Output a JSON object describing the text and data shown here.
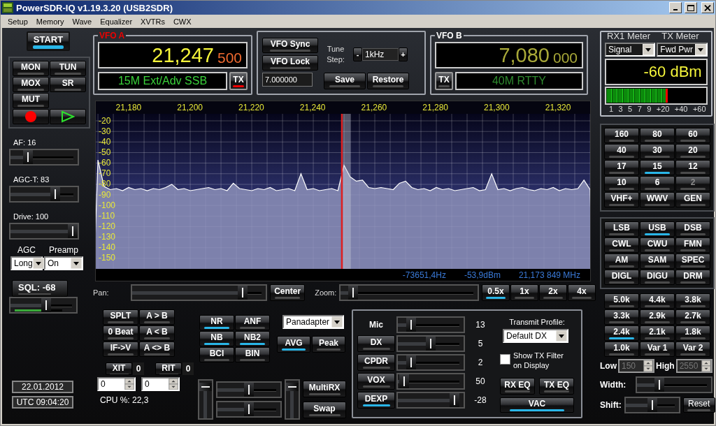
{
  "window": {
    "title": "PowerSDR-IQ v1.19.3.20 (USB2SDR)"
  },
  "menu": [
    "Setup",
    "Memory",
    "Wave",
    "Equalizer",
    "XVTRs",
    "CWX"
  ],
  "start_button": {
    "label": "START",
    "on": true
  },
  "main_buttons": [
    {
      "label": "MON",
      "on": false
    },
    {
      "label": "TUN",
      "on": false
    },
    {
      "label": "MOX",
      "on": false
    },
    {
      "label": "SR",
      "on": false
    },
    {
      "label": "MUT",
      "on": false
    }
  ],
  "left_sliders": [
    {
      "label": "AF:  16",
      "level": 0.22
    },
    {
      "label": "AGC-T:  83",
      "level": 0.7
    },
    {
      "label": "Drive:  100",
      "level": 1.0
    }
  ],
  "agc": {
    "label": "AGC",
    "value": "Long"
  },
  "preamp": {
    "label": "Preamp",
    "value": "On"
  },
  "squelch": {
    "label": "SQL:  -68",
    "on": false,
    "level": 0.55
  },
  "date": "22.01.2012",
  "time": "UTC 09:04:20",
  "vfo_a": {
    "title": "VFO A",
    "freq_main": "21,247",
    "freq_sub": "500",
    "band": "15M Ext/Adv SSB",
    "tx_label": "TX",
    "tx_on": true
  },
  "vfo_controls": {
    "sync": "VFO Sync",
    "lock": "VFO Lock",
    "freq_entry": "7.000000",
    "tune_step_label": "Tune Step:",
    "step_minus": "-",
    "step_value": "1kHz",
    "step_plus": "+",
    "save": "Save",
    "restore": "Restore"
  },
  "vfo_b": {
    "title": "VFO B",
    "freq_main": "7,080",
    "freq_sub": "000",
    "band": "40M RTTY",
    "tx_label": "TX",
    "tx_on": false
  },
  "meter": {
    "rx_title": "RX1 Meter",
    "tx_title": "TX Meter",
    "rx_mode": "Signal",
    "tx_mode": "Fwd Pwr",
    "reading": "-60 dBm",
    "level": 0.62,
    "scale": [
      "1",
      "3",
      "5",
      "7",
      "9",
      "+20",
      "+40",
      "+60"
    ]
  },
  "spectrum": {
    "chart_data": {
      "type": "area",
      "grid": true,
      "x": [
        21170,
        21172,
        21174,
        21176,
        21178,
        21180,
        21182,
        21184,
        21186,
        21188,
        21190,
        21192,
        21194,
        21196,
        21198,
        21200,
        21202,
        21204,
        21206,
        21208,
        21210,
        21212,
        21214,
        21216,
        21218,
        21220,
        21222,
        21224,
        21226,
        21228,
        21230,
        21232,
        21234,
        21236,
        21238,
        21240,
        21242,
        21244,
        21246,
        21248,
        21250,
        21252,
        21254,
        21256,
        21258,
        21260,
        21262,
        21264,
        21266,
        21268,
        21270,
        21272,
        21274,
        21276,
        21278,
        21280,
        21282,
        21284,
        21286,
        21288,
        21290,
        21292,
        21294,
        21296,
        21298,
        21300,
        21302,
        21304,
        21306,
        21308,
        21310,
        21312,
        21314,
        21316,
        21318,
        21320,
        21322,
        21324,
        21326,
        21328,
        21330
      ],
      "series": [
        {
          "color": "#ffffff",
          "values": [
            -57,
            -82,
            -85,
            -84,
            -86,
            -83,
            -85,
            -84,
            -86,
            -84,
            -85,
            -83,
            -80,
            -85,
            -84,
            -86,
            -85,
            -84,
            -83,
            -85,
            -84,
            -86,
            -79,
            -84,
            -85,
            -86,
            -84,
            -85,
            -83,
            -86,
            -85,
            -84,
            -86,
            -70,
            -85,
            -84,
            -86,
            -85,
            -84,
            -86,
            -62,
            -73,
            -77,
            -76,
            -83,
            -84,
            -83,
            -84,
            -85,
            -79,
            -77,
            -83,
            -85,
            -84,
            -86,
            -83,
            -85,
            -84,
            -86,
            -85,
            -84,
            -83,
            -86,
            -85,
            -70,
            -85,
            -84,
            -86,
            -84,
            -83,
            -85,
            -86,
            -84,
            -85,
            -83,
            -86,
            -84,
            -85,
            -84,
            -76,
            -85
          ]
        }
      ],
      "ref_lines": [
        {
          "axis": "x",
          "value": 21249.3,
          "color": "#e02020"
        }
      ],
      "bands": [
        {
          "axis": "x",
          "from": 21249.6,
          "to": 21252.2,
          "color": "#c8cad8"
        }
      ],
      "xlim": [
        21169.3,
        21330.0
      ],
      "ylim": [
        -159.9,
        -13.4
      ],
      "xticks": [
        {
          "value": 21180,
          "label": "21,180"
        },
        {
          "value": 21200,
          "label": "21,200"
        },
        {
          "value": 21220,
          "label": "21,220"
        },
        {
          "value": 21240,
          "label": "21,240"
        },
        {
          "value": 21260,
          "label": "21,260"
        },
        {
          "value": 21280,
          "label": "21,280"
        },
        {
          "value": 21300,
          "label": "21,300"
        },
        {
          "value": 21320,
          "label": "21,320"
        }
      ],
      "yticks": [
        -20,
        -30,
        -40,
        -50,
        -60,
        -70,
        -80,
        -90,
        -100,
        -110,
        -120,
        -130,
        -140,
        -150
      ]
    },
    "cursor_offset": "-73651,4Hz",
    "cursor_level": "-53,9dBm",
    "cursor_freq": "21,173 849 MHz"
  },
  "pan": {
    "label": "Pan:",
    "level": 0.85,
    "center": "Center"
  },
  "zoom": {
    "label": "Zoom:",
    "level": 0.06,
    "buttons": [
      {
        "label": "0.5x",
        "selected": true
      },
      {
        "label": "1x",
        "selected": false
      },
      {
        "label": "2x",
        "selected": false
      },
      {
        "label": "4x",
        "selected": false
      }
    ]
  },
  "bands": [
    {
      "label": "160",
      "selected": false,
      "disabled": false
    },
    {
      "label": "80",
      "selected": false,
      "disabled": false
    },
    {
      "label": "60",
      "selected": false,
      "disabled": false
    },
    {
      "label": "40",
      "selected": false,
      "disabled": false
    },
    {
      "label": "30",
      "selected": false,
      "disabled": false
    },
    {
      "label": "20",
      "selected": false,
      "disabled": false
    },
    {
      "label": "17",
      "selected": false,
      "disabled": false
    },
    {
      "label": "15",
      "selected": true,
      "disabled": false
    },
    {
      "label": "12",
      "selected": false,
      "disabled": false
    },
    {
      "label": "10",
      "selected": false,
      "disabled": false
    },
    {
      "label": "6",
      "selected": false,
      "disabled": false
    },
    {
      "label": "2",
      "selected": false,
      "disabled": true
    },
    {
      "label": "VHF+",
      "selected": false,
      "disabled": false
    },
    {
      "label": "WWV",
      "selected": false,
      "disabled": false
    },
    {
      "label": "GEN",
      "selected": false,
      "disabled": false
    }
  ],
  "modes": [
    {
      "label": "LSB",
      "selected": false
    },
    {
      "label": "USB",
      "selected": true
    },
    {
      "label": "DSB",
      "selected": false
    },
    {
      "label": "CWL",
      "selected": false
    },
    {
      "label": "CWU",
      "selected": false
    },
    {
      "label": "FMN",
      "selected": false
    },
    {
      "label": "AM",
      "selected": false
    },
    {
      "label": "SAM",
      "selected": false
    },
    {
      "label": "SPEC",
      "selected": false
    },
    {
      "label": "DIGL",
      "selected": false
    },
    {
      "label": "DIGU",
      "selected": false
    },
    {
      "label": "DRM",
      "selected": false
    }
  ],
  "filters": [
    {
      "label": "5.0k",
      "selected": false
    },
    {
      "label": "4.4k",
      "selected": false
    },
    {
      "label": "3.8k",
      "selected": false
    },
    {
      "label": "3.3k",
      "selected": false
    },
    {
      "label": "2.9k",
      "selected": false
    },
    {
      "label": "2.7k",
      "selected": false
    },
    {
      "label": "2.4k",
      "selected": true
    },
    {
      "label": "2.1k",
      "selected": false
    },
    {
      "label": "1.8k",
      "selected": false
    },
    {
      "label": "1.0k",
      "selected": false
    },
    {
      "label": "Var 1",
      "selected": false
    },
    {
      "label": "Var 2",
      "selected": false
    }
  ],
  "filter_low": {
    "label": "Low",
    "value": "150",
    "disabled": true
  },
  "filter_high": {
    "label": "High",
    "value": "2550",
    "disabled": true
  },
  "filter_width": {
    "label": "Width:",
    "level": 0.27
  },
  "filter_shift": {
    "label": "Shift:",
    "level": 0.5,
    "reset": "Reset"
  },
  "vfo_buttons": [
    {
      "label": "SPLT",
      "on": false
    },
    {
      "label": "A > B",
      "on": false
    },
    {
      "label": "0 Beat",
      "on": false
    },
    {
      "label": "A < B",
      "on": false
    },
    {
      "label": "IF->V",
      "on": false
    },
    {
      "label": "A <> B",
      "on": false
    }
  ],
  "xit": {
    "label": "XIT",
    "value": "0",
    "entry": "0",
    "on": false
  },
  "rit": {
    "label": "RIT",
    "value": "0",
    "entry": "0",
    "on": false
  },
  "cpu": "CPU %:  22,3",
  "dsp_buttons": [
    {
      "label": "NR",
      "on": true
    },
    {
      "label": "ANF",
      "on": false
    },
    {
      "label": "NB",
      "on": true
    },
    {
      "label": "NB2",
      "on": true
    },
    {
      "label": "BCI",
      "on": false
    },
    {
      "label": "BIN",
      "on": false
    }
  ],
  "display_mode": "Panadapter",
  "display_buttons": [
    {
      "label": "AVG",
      "on": true
    },
    {
      "label": "Peak",
      "on": false
    }
  ],
  "mixer": {
    "volume_sliders": [
      {
        "level": 0.92
      },
      {
        "level": 0.92
      }
    ],
    "balance_sliders": [
      {
        "level": 0.5
      },
      {
        "level": 0.5
      }
    ],
    "multirx": "MultiRX",
    "swap": "Swap"
  },
  "transmit": {
    "rows": [
      {
        "kind": "label",
        "label": "Mic",
        "level": 0.15,
        "value": "13"
      },
      {
        "kind": "button",
        "label": "DX",
        "level": 0.5,
        "value": "5",
        "on": false
      },
      {
        "kind": "button",
        "label": "CPDR",
        "level": 0.15,
        "value": "2",
        "on": false
      },
      {
        "kind": "button",
        "label": "VOX",
        "level": 0.03,
        "value": "50",
        "on": false
      },
      {
        "kind": "button",
        "label": "DEXP",
        "level": 0.92,
        "value": "-28",
        "on": true
      }
    ],
    "profile_label": "Transmit Profile:",
    "profile": "Default DX",
    "show_filter": {
      "label": "Show TX Filter on Display",
      "checked": false
    },
    "buttons": [
      {
        "label": "RX EQ",
        "on": false
      },
      {
        "label": "TX EQ",
        "on": false
      },
      {
        "label": "VAC",
        "on": true
      }
    ]
  }
}
